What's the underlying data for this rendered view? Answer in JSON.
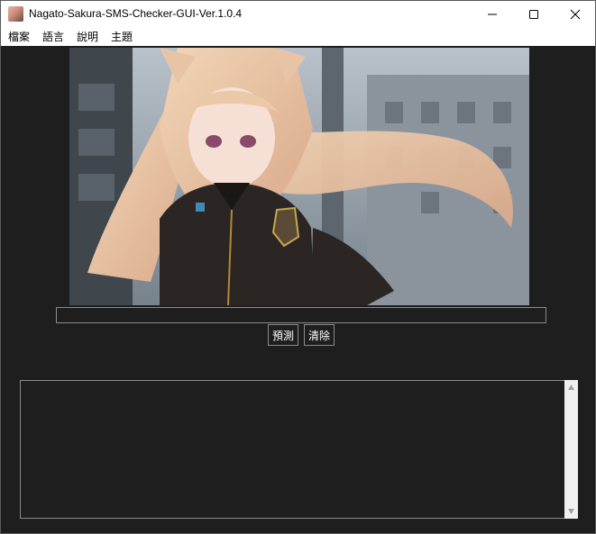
{
  "window": {
    "title": "Nagato-Sakura-SMS-Checker-GUI-Ver.1.0.4"
  },
  "menu": {
    "items": [
      {
        "label": "檔案"
      },
      {
        "label": "語言"
      },
      {
        "label": "說明"
      },
      {
        "label": "主題"
      }
    ]
  },
  "main": {
    "input_value": "",
    "predict_label": "預測",
    "clear_label": "清除",
    "output_text": ""
  },
  "colors": {
    "background": "#1e1e1e",
    "border": "#8a8a8a",
    "titlebar": "#ffffff"
  },
  "icons": {
    "app": "app-icon",
    "minimize": "minimize-icon",
    "maximize": "maximize-icon",
    "close": "close-icon",
    "scroll_up": "scroll-up-arrow-icon",
    "scroll_down": "scroll-down-arrow-icon"
  }
}
